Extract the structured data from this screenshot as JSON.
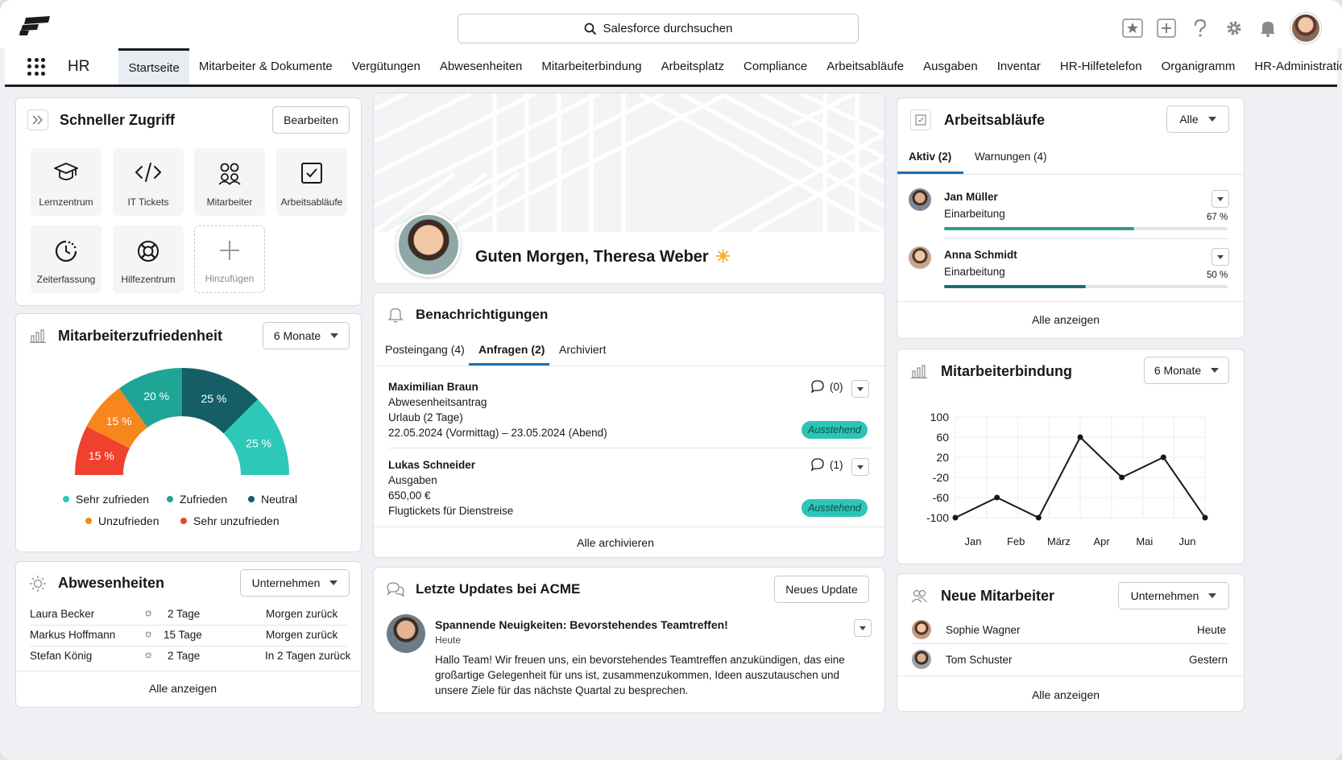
{
  "top": {
    "search_placeholder": "Salesforce durchsuchen"
  },
  "nav": {
    "app_name": "HR",
    "items": [
      "Startseite",
      "Mitarbeiter & Dokumente",
      "Vergütungen",
      "Abwesenheiten",
      "Mitarbeiterbindung",
      "Arbeitsplatz",
      "Compliance",
      "Arbeitsabläufe",
      "Ausgaben",
      "Inventar",
      "HR-Hilfetelefon",
      "Organigramm",
      "HR-Administration"
    ],
    "active": "Startseite"
  },
  "quick_access": {
    "title": "Schneller Zugriff",
    "edit_label": "Bearbeiten",
    "tiles": [
      {
        "label": "Lernzentrum",
        "icon": "graduation-cap-icon"
      },
      {
        "label": "IT Tickets",
        "icon": "code-icon"
      },
      {
        "label": "Mitarbeiter",
        "icon": "people-icon"
      },
      {
        "label": "Arbeitsabläufe",
        "icon": "checkbox-icon"
      },
      {
        "label": "Zeiterfassung",
        "icon": "clock-icon"
      },
      {
        "label": "Hilfezentrum",
        "icon": "lifebuoy-icon"
      },
      {
        "label": "Hinzufügen",
        "icon": "plus-icon"
      }
    ]
  },
  "satisfaction": {
    "title": "Mitarbeiterzufriedenheit",
    "range_label": "6 Monate",
    "legend": [
      "Sehr zufrieden",
      "Zufrieden",
      "Neutral",
      "Unzufrieden",
      "Sehr unzufrieden"
    ]
  },
  "chart_data": [
    {
      "type": "pie",
      "title": "Mitarbeiterzufriedenheit",
      "categories": [
        "Sehr unzufrieden",
        "Unzufrieden",
        "Sehr zufrieden",
        "Neutral",
        "Zufrieden"
      ],
      "values": [
        15,
        15,
        20,
        25,
        25
      ],
      "labels": [
        "15 %",
        "15 %",
        "20 %",
        "25 %",
        "25 %"
      ],
      "colors": [
        "#f0412f",
        "#f7861c",
        "#1ea596",
        "#165e66",
        "#2ec8b8"
      ],
      "legend_colors": {
        "Sehr zufrieden": "#2ec8b8",
        "Zufrieden": "#1ea596",
        "Neutral": "#165e66",
        "Unzufrieden": "#f7861c",
        "Sehr unzufrieden": "#f0412f"
      }
    },
    {
      "type": "line",
      "title": "Mitarbeiterbindung",
      "categories": [
        "Jan",
        "Feb",
        "März",
        "Apr",
        "Mai",
        "Jun"
      ],
      "x": [
        0,
        1,
        1.75,
        2.5,
        3.35,
        4.0,
        5.0,
        6.0
      ],
      "values": [
        -100,
        -60,
        -100,
        60,
        -20,
        20,
        -100
      ],
      "yticks": [
        100,
        60,
        20,
        -20,
        -60,
        -100
      ],
      "ylim": [
        -100,
        100
      ],
      "grid": true
    }
  ],
  "absences": {
    "title": "Abwesenheiten",
    "filter_label": "Unternehmen",
    "rows": [
      {
        "name": "Laura Becker",
        "days": "2 Tage",
        "status": "Morgen zurück"
      },
      {
        "name": "Markus Hoffmann",
        "days": "15 Tage",
        "status": "Morgen zurück"
      },
      {
        "name": "Stefan König",
        "days": "2 Tage",
        "status": "In 2 Tagen zurück"
      }
    ],
    "show_all": "Alle anzeigen"
  },
  "welcome": {
    "greeting": "Guten Morgen, Theresa Weber",
    "sun": "☀"
  },
  "notifications": {
    "title": "Benachrichtigungen",
    "tabs": [
      "Posteingang (4)",
      "Anfragen (2)",
      "Archiviert"
    ],
    "active_tab": "Anfragen (2)",
    "items": [
      {
        "name": "Maximilian Braun",
        "type": "Abwesenheitsantrag",
        "detail": "Urlaub (2 Tage)",
        "extra": "22.05.2024 (Vormittag) – 23.05.2024 (Abend)",
        "comments": "(0)",
        "status": "Ausstehend"
      },
      {
        "name": "Lukas Schneider",
        "type": "Ausgaben",
        "detail": "650,00 €",
        "extra": "Flugtickets für Dienstreise",
        "comments": "(1)",
        "status": "Ausstehend"
      }
    ],
    "archive_all": "Alle archivieren"
  },
  "updates": {
    "title": "Letzte Updates bei ACME",
    "new_label": "Neues Update",
    "post": {
      "title": "Spannende Neuigkeiten: Bevorstehendes Teamtreffen!",
      "when": "Heute",
      "body_lines": [
        "Hallo Team! Wir freuen uns, ein bevorstehendes Teamtreffen anzukündigen, das eine",
        "großartige Gelegenheit für uns ist, zusammenzukommen, Ideen auszutauschen und",
        "unsere Ziele für das nächste Quartal zu besprechen."
      ]
    }
  },
  "workflows": {
    "title": "Arbeitsabläufe",
    "filter_label": "Alle",
    "tabs": [
      "Aktiv (2)",
      "Warnungen (4)"
    ],
    "active_tab": "Aktiv (2)",
    "items": [
      {
        "name": "Jan Müller",
        "task": "Einarbeitung",
        "progress_label": "67 %",
        "progress": 0.67
      },
      {
        "name": "Anna Schmidt",
        "task": "Einarbeitung",
        "progress_label": "50 %",
        "progress": 0.5
      }
    ],
    "show_all": "Alle anzeigen"
  },
  "retention": {
    "title": "Mitarbeiterbindung",
    "range_label": "6 Monate"
  },
  "new_employees": {
    "title": "Neue Mitarbeiter",
    "filter_label": "Unternehmen",
    "rows": [
      {
        "name": "Sophie Wagner",
        "when": "Heute"
      },
      {
        "name": "Tom Schuster",
        "when": "Gestern"
      }
    ],
    "show_all": "Alle anzeigen"
  }
}
